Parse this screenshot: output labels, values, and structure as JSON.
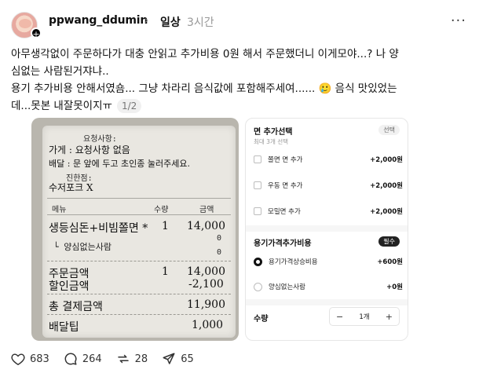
{
  "post": {
    "username": "ppwang_ddumin",
    "topic": "일상",
    "time": "3시간",
    "add_badge": "+",
    "chevron": "›",
    "more": "···",
    "body_lines": [
      "아무생각없이 주문하다가 대충 안읽고 추가비용 0원 해서 주문했더니 이게모야...? 나 양",
      "심없는 사람된거쟈냐..",
      "용기 추가비용 안해서였숌... 그냥 차라리 음식값에 포함해주세여...... 🥲 음식 맛있었는",
      "데...못본 내잘못이지ㅠ"
    ],
    "pager": "1/2"
  },
  "receipt": {
    "request_label": "요청사항:",
    "store_line": "가게 : 요청사항 없음",
    "delivery_line": "배달 : 문 앞에 두고 초인종 눌러주세요.",
    "utensil_label": "진한점:",
    "utensil_line": "수저포크 X",
    "col_menu": "메뉴",
    "col_qty": "수량",
    "col_amount": "금액",
    "item_name": "생등심돈+비빔쫄면 *",
    "item_qty": "1",
    "item_amount": "14,000",
    "item_zero": "0",
    "sub_item": "└ 양심없는사람",
    "sub_zero": "0",
    "order_total_label": "주문금액",
    "order_total_qty": "1",
    "order_total_amount": "14,000",
    "discount_label": "할인금액",
    "discount_amount": "-2,100",
    "pay_total_label": "총 결제금액",
    "pay_total_amount": "11,900",
    "tip_label": "배달팁",
    "tip_amount": "1,000"
  },
  "option_screen": {
    "title": "면 추가선택",
    "badge": "선택",
    "subtitle": "최대 3개 선택",
    "options": [
      {
        "label": "쫄면 면 추가",
        "price": "+2,000원"
      },
      {
        "label": "우동 면 추가",
        "price": "+2,000원"
      },
      {
        "label": "모밀면 추가",
        "price": "+2,000원"
      }
    ],
    "section2_title": "용기가격추가비용",
    "section2_badge": "필수",
    "radios": [
      {
        "label": "용기가격상승비용",
        "price": "+600원",
        "selected": true
      },
      {
        "label": "양심없는사람",
        "price": "+0원",
        "selected": false
      }
    ],
    "qty_label": "수량",
    "qty_minus": "−",
    "qty_value": "1개",
    "qty_plus": "+"
  },
  "stats": {
    "likes": "683",
    "comments": "264",
    "reposts": "28",
    "shares": "65"
  }
}
